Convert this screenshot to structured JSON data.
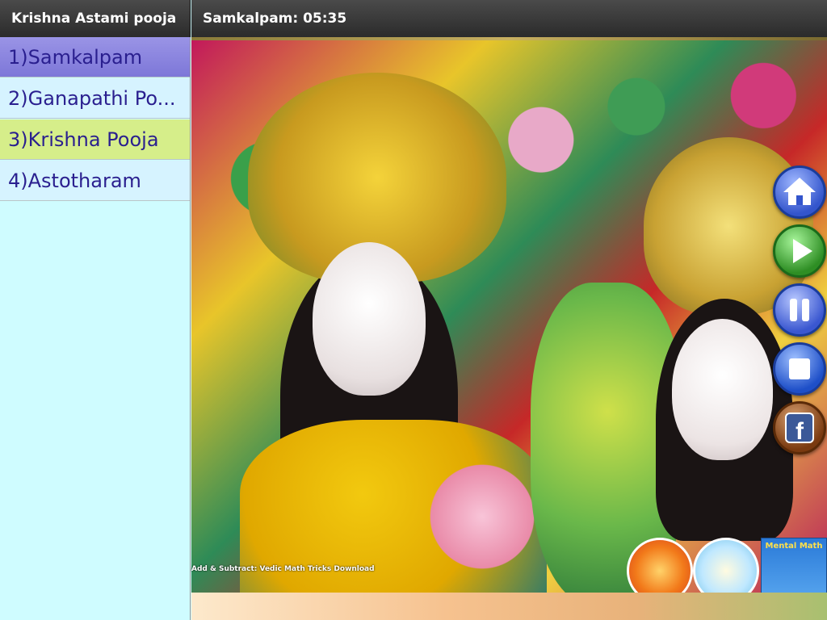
{
  "header": {
    "app_title": "Krishna Astami pooja",
    "current_track": "Samkalpam: 05:35"
  },
  "sidebar": {
    "items": [
      {
        "label": "1)Samkalpam"
      },
      {
        "label": "2)Ganapathi Po..."
      },
      {
        "label": "3)Krishna Pooja"
      },
      {
        "label": "4)Astotharam"
      }
    ]
  },
  "ad_banner": {
    "text": "Add & Subtract: Vedic Math Tricks Download"
  },
  "ads": {
    "ad3_title": "Mental Math"
  },
  "colors": {
    "header_bg": "#3a3a3a",
    "sidebar_bg": "#cffcff",
    "selected_item": "#8a84de",
    "highlight_item": "#d6ee8a",
    "item_text": "#2a1f8f"
  },
  "icons": {
    "home": "home-icon",
    "play": "play-icon",
    "pause": "pause-icon",
    "stop": "stop-icon",
    "facebook": "facebook-icon"
  }
}
